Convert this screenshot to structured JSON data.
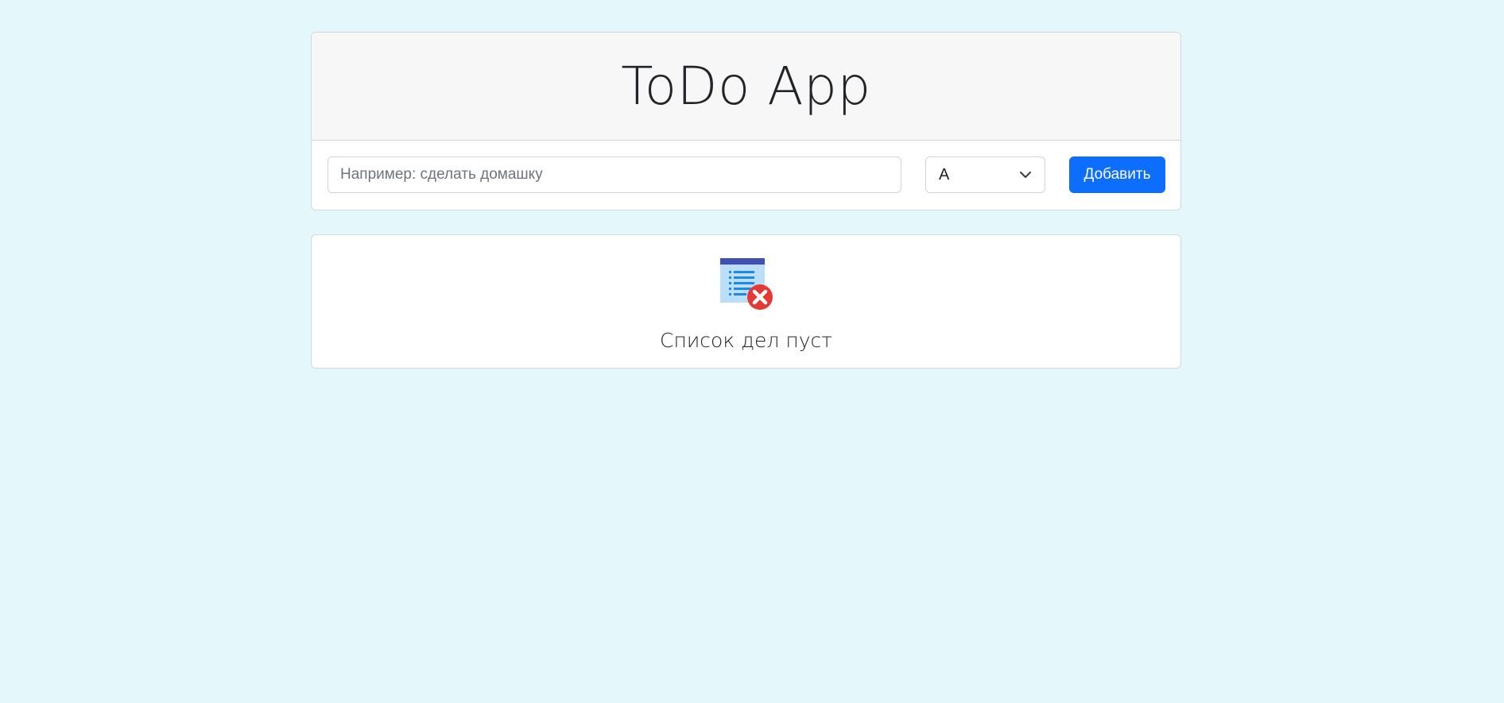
{
  "header": {
    "title": "ToDo App"
  },
  "form": {
    "task_placeholder": "Например: сделать домашку",
    "task_value": "",
    "priority_selected": "A",
    "add_label": "Добавить"
  },
  "empty_state": {
    "icon": "empty-list-icon",
    "message": "Список дел пуст"
  },
  "colors": {
    "background": "#e4f7fb",
    "primary": "#0d6efd",
    "error_badge": "#e53935"
  }
}
